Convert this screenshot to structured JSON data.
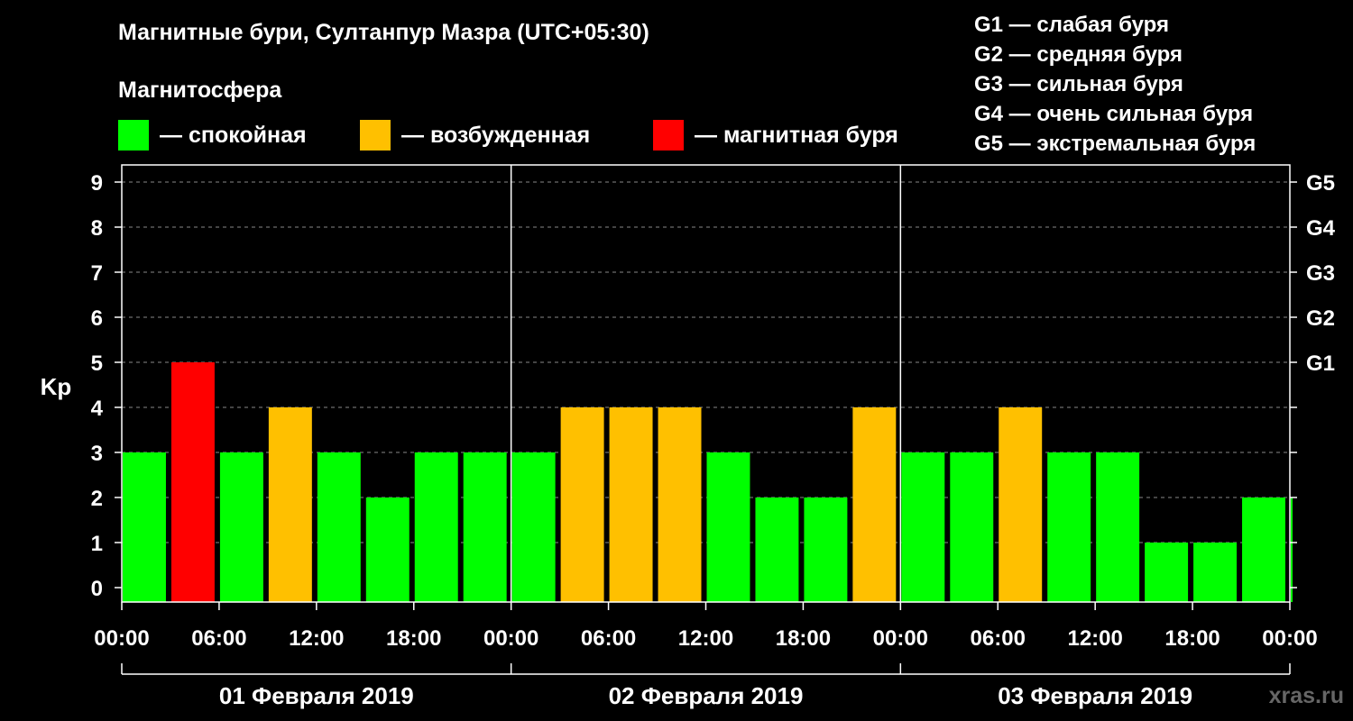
{
  "title": "Магнитные бури, Султанпур Мазра (UTC+05:30)",
  "magnetosphere_label": "Магнитосфера",
  "legend": [
    {
      "label": "— спокойная",
      "color": "#00ff00"
    },
    {
      "label": "— возбужденная",
      "color": "#ffc000"
    },
    {
      "label": "— магнитная буря",
      "color": "#ff0000"
    }
  ],
  "g_scale": [
    "G1 — слабая буря",
    "G2 — средняя буря",
    "G3 — сильная буря",
    "G4 — очень сильная буря",
    "G5 — экстремальная буря"
  ],
  "watermark": "xras.ru",
  "chart_data": {
    "type": "bar",
    "ylabel": "Kp",
    "ylim": [
      0,
      9
    ],
    "y_ticks": [
      "0",
      "1",
      "2",
      "3",
      "4",
      "5",
      "6",
      "7",
      "8",
      "9"
    ],
    "right_axis_labels": [
      {
        "kp": 5,
        "label": "G1"
      },
      {
        "kp": 6,
        "label": "G2"
      },
      {
        "kp": 7,
        "label": "G3"
      },
      {
        "kp": 8,
        "label": "G4"
      },
      {
        "kp": 9,
        "label": "G5"
      }
    ],
    "x_tick_labels": [
      "00:00",
      "06:00",
      "12:00",
      "18:00",
      "00:00",
      "06:00",
      "12:00",
      "18:00",
      "00:00",
      "06:00",
      "12:00",
      "18:00",
      "00:00"
    ],
    "days": [
      "01 Февраля 2019",
      "02 Февраля 2019",
      "03 Февраля 2019"
    ],
    "values": [
      3,
      5,
      3,
      4,
      3,
      2,
      3,
      3,
      3,
      4,
      4,
      4,
      3,
      2,
      2,
      4,
      3,
      3,
      4,
      3,
      3,
      1,
      1,
      2,
      2
    ],
    "grid": true,
    "colors": {
      "quiet": "#00ff00",
      "active": "#ffc000",
      "storm": "#ff0000"
    }
  }
}
